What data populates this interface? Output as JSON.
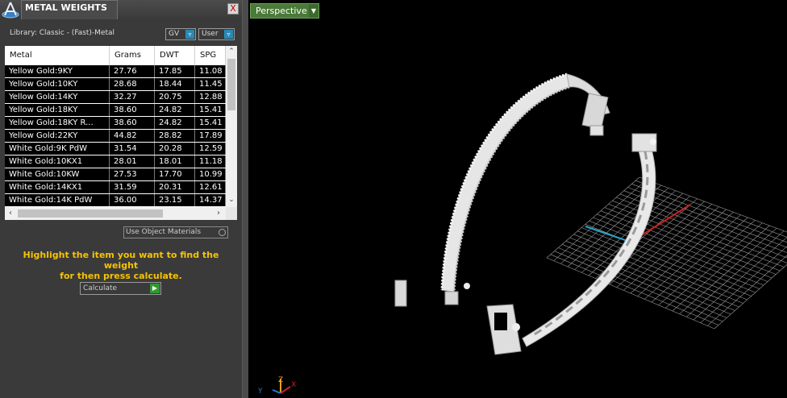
{
  "panel": {
    "title": "METAL WEIGHTS",
    "close_glyph": "X",
    "library_label": "Library: Classic - (Fast)-Metal",
    "gv_label": "GV",
    "user_label": "User",
    "toggle_icon": "down-arrow-icon"
  },
  "table": {
    "columns": [
      "Metal",
      "Grams",
      "DWT",
      "SPG"
    ],
    "rows": [
      [
        "Yellow Gold:9KY",
        "27.76",
        "17.85",
        "11.08"
      ],
      [
        "Yellow Gold:10KY",
        "28.68",
        "18.44",
        "11.45"
      ],
      [
        "Yellow Gold:14KY",
        "32.27",
        "20.75",
        "12.88"
      ],
      [
        "Yellow Gold:18KY",
        "38.60",
        "24.82",
        "15.41"
      ],
      [
        "Yellow Gold:18KY R...",
        "38.60",
        "24.82",
        "15.41"
      ],
      [
        "Yellow Gold:22KY",
        "44.82",
        "28.82",
        "17.89"
      ],
      [
        "White Gold:9K PdW",
        "31.54",
        "20.28",
        "12.59"
      ],
      [
        "White Gold:10KX1",
        "28.01",
        "18.01",
        "11.18"
      ],
      [
        "White Gold:10KW",
        "27.53",
        "17.70",
        "10.99"
      ],
      [
        "White Gold:14KX1",
        "31.59",
        "20.31",
        "12.61"
      ],
      [
        "White Gold:14K PdW",
        "36.00",
        "23.15",
        "14.37"
      ]
    ]
  },
  "options": {
    "use_object_materials": "Use Object Materials"
  },
  "hint_line1": "Highlight the item you want to find the weight",
  "hint_line2": "for then press calculate.",
  "calculate_label": "Calculate",
  "viewport": {
    "view_label": "Perspective",
    "axis_labels": {
      "z": "Z",
      "x": "X",
      "y": "Y"
    }
  },
  "colors": {
    "panel_bg": "#3a3a3a",
    "hint": "#f7c300",
    "perspective_tab": "#4a7a38",
    "grid": "#9a9a9a",
    "x_axis": "#cc2222",
    "y_axis": "#22a8c8",
    "model": "#e6e6e6"
  }
}
